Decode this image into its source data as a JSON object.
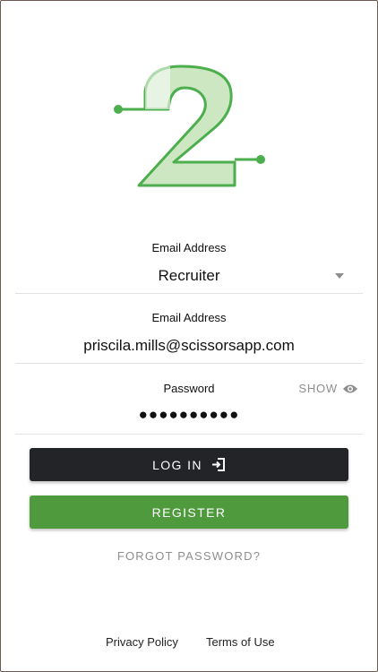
{
  "logo": {
    "name": "2",
    "accent": "#4cae4c",
    "fill": "#cde7c2"
  },
  "form": {
    "role_field": {
      "label": "Email Address",
      "value": "Recruiter"
    },
    "email_field": {
      "label": "Email Address",
      "value": "priscila.mills@scissorsapp.com"
    },
    "password_field": {
      "label": "Password",
      "value": "●●●●●●●●●●",
      "show_label": "SHOW"
    }
  },
  "buttons": {
    "login_label": "LOG IN",
    "register_label": "REGISTER",
    "forgot_label": "FORGOT PASSWORD?"
  },
  "footer": {
    "privacy": "Privacy Policy",
    "terms": "Terms of Use"
  },
  "icons": {
    "eye": "eye-icon",
    "login": "login-arrow-icon",
    "dropdown": "caret-down-icon"
  }
}
